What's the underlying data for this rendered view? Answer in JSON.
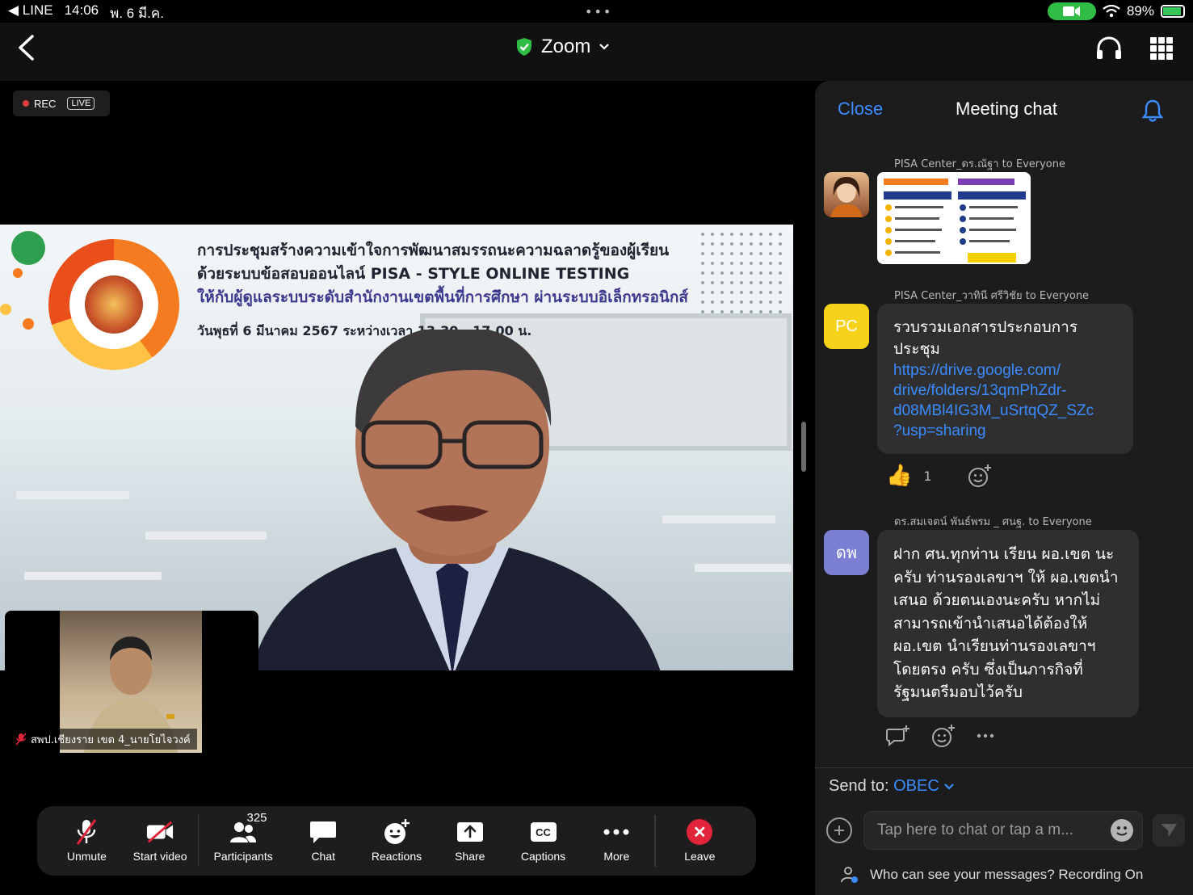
{
  "status_bar": {
    "back_app": "◀ LINE",
    "time": "14:06",
    "date": "พ. 6 มี.ค.",
    "battery": "89%"
  },
  "top_nav": {
    "title": "Zoom"
  },
  "recording": {
    "rec_label": "REC",
    "live_label": "LIVE"
  },
  "slide": {
    "line1": "การประชุมสร้างความเข้าใจการพัฒนาสมรรถนะความฉลาดรู้ของผู้เรียน",
    "line2": "ด้วยระบบข้อสอบออนไลน์ PISA - STYLE ONLINE TESTING",
    "line3": "ให้กับผู้ดูแลระบบระดับสำนักงานเขตพื้นที่การศึกษา ผ่านระบบอิเล็กทรอนิกส์",
    "date_line": "วันพุธที่ 6 มีนาคม 2567 ระหว่างเวลา 13.30 - 17.00 น."
  },
  "self_view": {
    "name": "สพป.เชียงราย เขต 4_นายโยไจวงค์"
  },
  "toolbar": {
    "unmute": "Unmute",
    "start_video": "Start video",
    "participants": "Participants",
    "participants_count": "325",
    "chat": "Chat",
    "reactions": "Reactions",
    "share": "Share",
    "captions": "Captions",
    "captions_glyph": "CC",
    "more": "More",
    "leave": "Leave"
  },
  "chat_panel": {
    "close": "Close",
    "title": "Meeting chat",
    "messages": [
      {
        "sender": "PISA Center_ดร.ณัฐา to Everyone",
        "type": "image"
      },
      {
        "sender": "PISA Center_วาทินี ศรีวิชัย to Everyone",
        "avatar": "PC",
        "text": "รวบรวมเอกสารประกอบการประชุม",
        "link_lines": [
          "https://drive.google.com/",
          "drive/folders/13qmPhZdr-",
          "d08MBl4IG3M_uSrtqQZ_SZc",
          "?usp=sharing"
        ],
        "reaction_emoji": "👍",
        "reaction_count": "1"
      },
      {
        "sender": "ดร.สมเจตน์ พันธ์พรม _ ศนฐ. to Everyone",
        "avatar": "ดพ",
        "text": "ฝาก ศน.ทุกท่าน เรียน ผอ.เขต นะครับ ท่านรองเลขาฯ ให้ ผอ.เขตนำเสนอ ด้วยตนเองนะครับ หากไม่สามารถเข้านำเสนอได้ต้องให้ ผอ.เขต นำเรียนท่านรองเลขาฯ โดยตรง ครับ ซึ่งเป็นภารกิจที่รัฐมนตรีมอบไว้ครับ"
      }
    ],
    "send_to_label": "Send to:",
    "send_to_target": "OBEC",
    "input_placeholder": "Tap here to chat or tap a m...",
    "privacy_text": "Who can see your messages? Recording On"
  },
  "colors": {
    "accent_blue": "#3a8cff",
    "leave_red": "#e0243a",
    "pc_avatar": "#f7d21a",
    "dp_avatar": "#7b7fd4",
    "camera_green": "#2fbd46"
  }
}
